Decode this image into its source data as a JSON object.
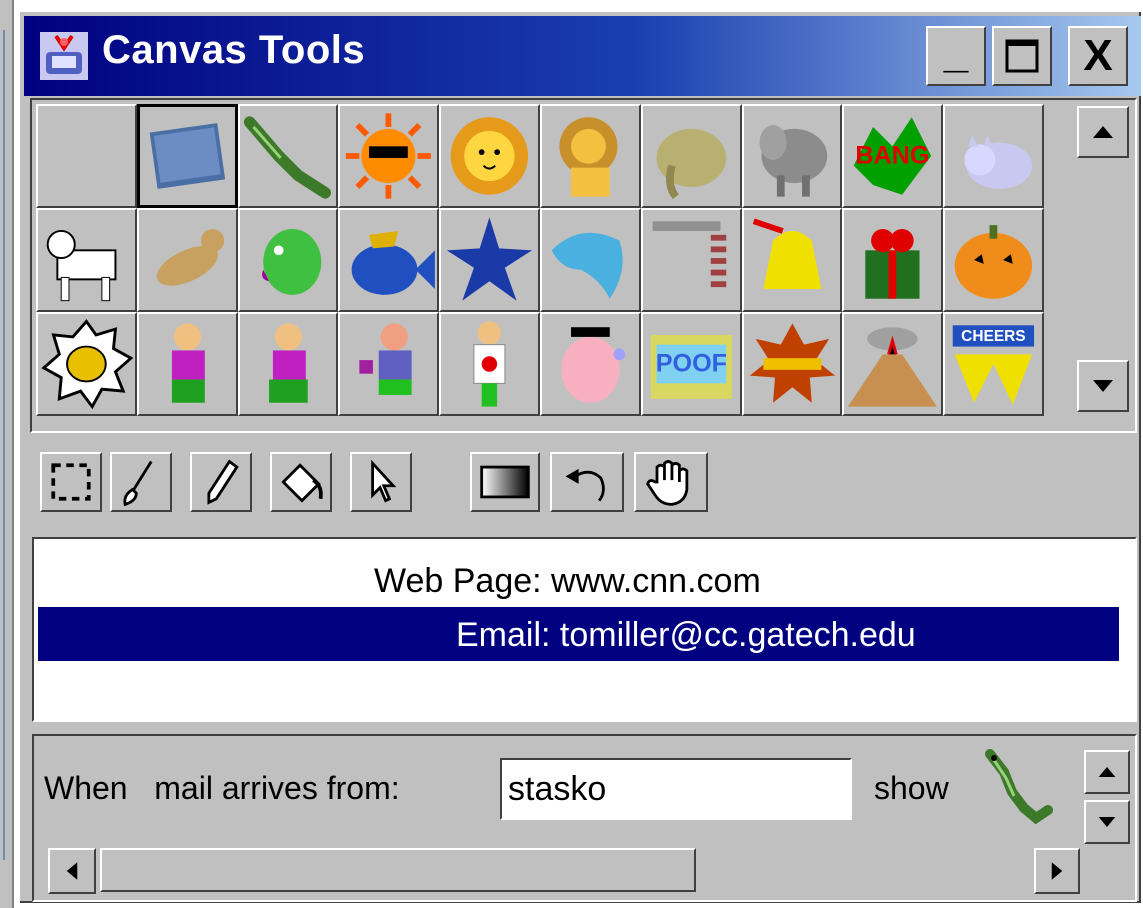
{
  "window": {
    "title": "Canvas Tools"
  },
  "titlebar_buttons": {
    "minimize": "_",
    "maximize": "□",
    "close": "X"
  },
  "palette": {
    "selected_index": 1,
    "items": [
      "blank",
      "notebook",
      "alligator",
      "sun-sunglasses",
      "lion-face",
      "lion",
      "elephant",
      "elephant-gray",
      "bang",
      "cat",
      "dog",
      "dog-running",
      "fish-green",
      "fish-blue",
      "starfish",
      "dolphin",
      "hammer",
      "bell",
      "gift",
      "pumpkin",
      "bell-burst",
      "person-walking-1",
      "person-walking-2",
      "man-coffee",
      "person-shirt",
      "man-pig-phone",
      "poof",
      "boom",
      "volcano",
      "cheers"
    ],
    "bang_text": "BANG",
    "poof_text": "POOF",
    "cheers_text": "CHEERS"
  },
  "tools": [
    "select-rect",
    "brush",
    "pencil",
    "paint-bucket",
    "pointer",
    "gradient",
    "undo",
    "hand"
  ],
  "list": {
    "rows": [
      {
        "label": "Web Page:  www.cnn.com",
        "selected": false
      },
      {
        "label": "Email:  tomiller@cc.gatech.edu",
        "selected": true
      }
    ]
  },
  "rule": {
    "when_label": "When   mail arrives from:",
    "from_value": "stasko",
    "show_label": "show"
  },
  "colors": {
    "title_start": "#000080",
    "selection": "#000080",
    "panel": "#c0c0c0"
  }
}
